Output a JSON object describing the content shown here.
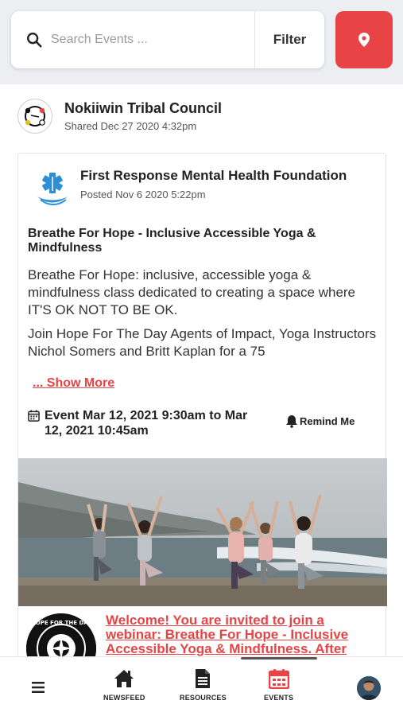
{
  "search": {
    "placeholder": "Search Events ...",
    "value": "",
    "filter_label": "Filter"
  },
  "share": {
    "org_name": "Nokiiwin Tribal Council",
    "shared_date": "Shared Dec 27 2020 4:32pm"
  },
  "post": {
    "org_name": "First Response Mental Health Foundation",
    "posted_date": "Posted Nov 6 2020 5:22pm",
    "event_title": "Breathe For Hope - Inclusive Accessible Yoga & Mindfulness",
    "description_p1": "Breathe For Hope: inclusive, accessible yoga & mindfulness class dedicated to creating a space where IT'S OK NOT TO BE OK.",
    "description_p2": "Join Hope For The Day Agents of Impact, Yoga Instructors Nichol Somers and Britt Kaplan for a 75",
    "show_more_label": "... Show More",
    "event_time": "Event Mar 12, 2021 9:30am to Mar 12, 2021 10:45am",
    "remind_label": "Remind Me",
    "linked_title": "Welcome! You are invited to join a webinar: Breathe For Hope - Inclusive Accessible Yoga & Mindfulness. After"
  },
  "logo_text": {
    "hope": "HOPE FOR THE DAY"
  },
  "nav": {
    "items": [
      {
        "label": "NEWSFEED",
        "icon": "home-icon"
      },
      {
        "label": "RESOURCES",
        "icon": "document-icon"
      },
      {
        "label": "EVENTS",
        "icon": "calendar-icon"
      }
    ],
    "active": "EVENTS"
  },
  "colors": {
    "accent": "#e84445",
    "background": "#eceef1"
  }
}
